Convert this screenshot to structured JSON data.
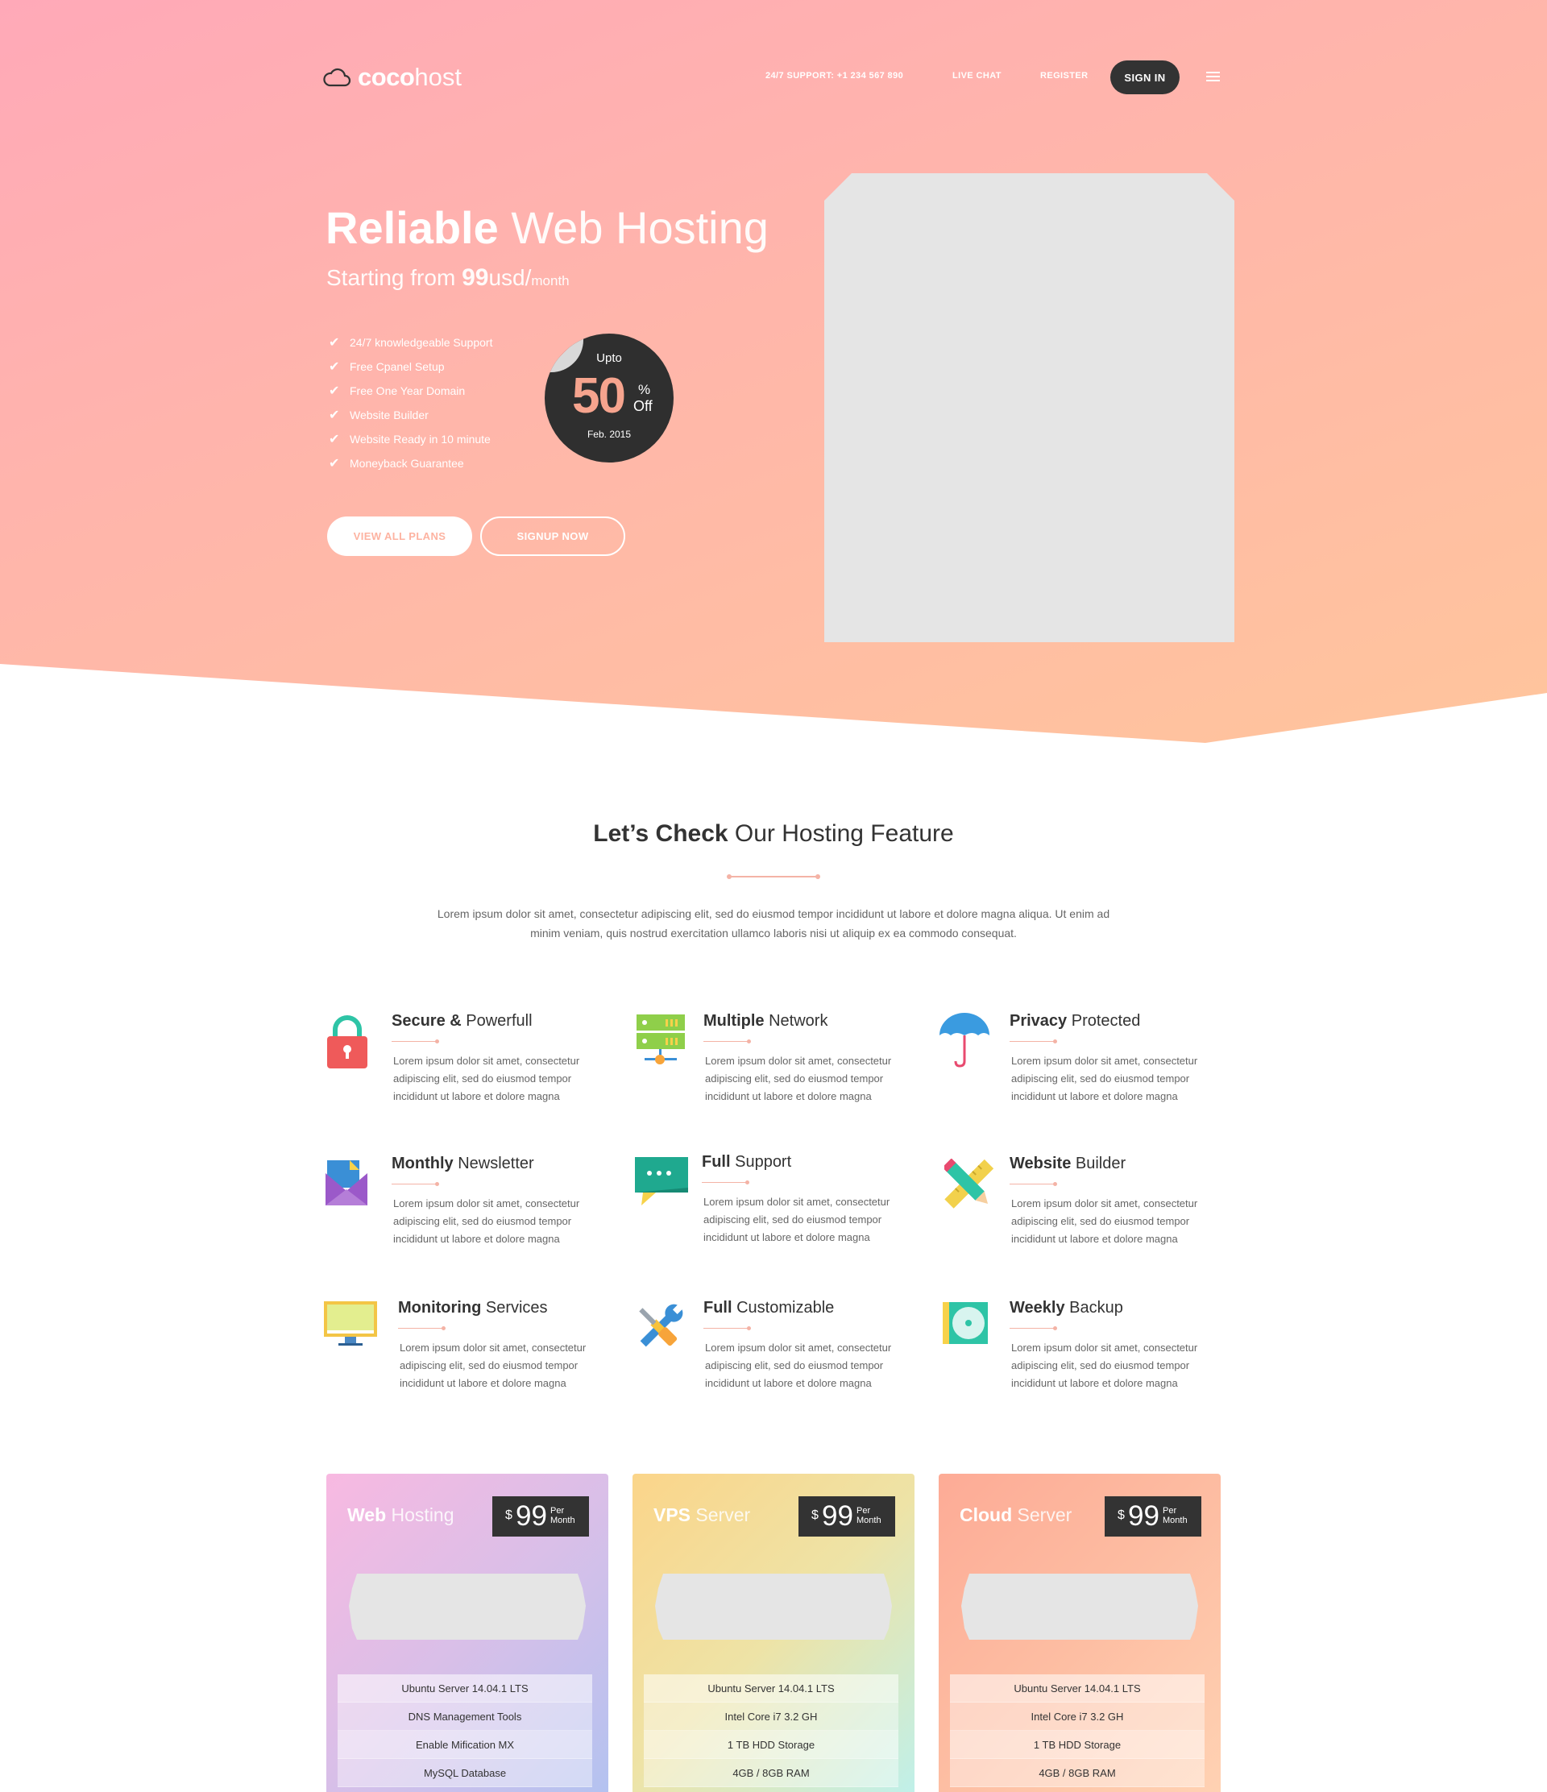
{
  "brand": {
    "bold": "coco",
    "light": "host"
  },
  "nav": {
    "support": "24/7 SUPPORT: +1 234 567 890",
    "live_chat": "LIVE CHAT",
    "register": "REGISTER",
    "sign_in": "SIGN IN"
  },
  "hero": {
    "title_bold": "Reliable",
    "title_light": "Web Hosting",
    "sub_prefix": "Starting from ",
    "sub_price": "99",
    "sub_unit": "usd/",
    "sub_period": "month",
    "list": [
      "24/7 knowledgeable Support",
      "Free Cpanel Setup",
      "Free One Year Domain",
      "Website Builder",
      "Website Ready in 10 minute",
      "Moneyback Guarantee"
    ],
    "badge": {
      "upto": "Upto",
      "num": "50",
      "pct": "%",
      "off": "Off",
      "date": "Feb. 2015"
    },
    "btn_plans": "VIEW ALL PLANS",
    "btn_signup": "SIGNUP NOW"
  },
  "features": {
    "title_bold": "Let’s Check",
    "title_light": " Our Hosting Feature",
    "desc": "Lorem ipsum dolor sit amet, consectetur adipiscing elit, sed do eiusmod tempor incididunt ut labore et dolore magna aliqua. Ut enim ad minim veniam, quis nostrud exercitation ullamco laboris nisi ut aliquip ex ea commodo consequat.",
    "items": [
      {
        "bold": "Secure &",
        "light": " Powerfull",
        "desc": "Lorem ipsum dolor sit amet, consectetur adipiscing elit, sed do eiusmod tempor incididunt ut labore et dolore magna",
        "icon": "padlock-icon"
      },
      {
        "bold": "Multiple",
        "light": " Network",
        "desc": "Lorem ipsum dolor sit amet, consectetur adipiscing elit, sed do eiusmod tempor incididunt ut labore et dolore magna",
        "icon": "server-network-icon"
      },
      {
        "bold": "Privacy",
        "light": " Protected",
        "desc": "Lorem ipsum dolor sit amet, consectetur adipiscing elit, sed do eiusmod tempor incididunt ut labore et dolore magna",
        "icon": "umbrella-icon"
      },
      {
        "bold": "Monthly",
        "light": " Newsletter",
        "desc": "Lorem ipsum dolor sit amet, consectetur adipiscing elit, sed do eiusmod tempor incididunt ut labore et dolore magna",
        "icon": "envelope-icon"
      },
      {
        "bold": "Full",
        "light": " Support",
        "desc": "Lorem ipsum dolor sit amet, consectetur adipiscing elit, sed do eiusmod tempor incididunt ut labore et dolore magna",
        "icon": "chat-bubble-icon"
      },
      {
        "bold": "Website",
        "light": " Builder",
        "desc": "Lorem ipsum dolor sit amet, consectetur adipiscing elit, sed do eiusmod tempor incididunt ut labore et dolore magna",
        "icon": "pencil-ruler-icon"
      },
      {
        "bold": "Monitoring",
        "light": " Services",
        "desc": "Lorem ipsum dolor sit amet, consectetur adipiscing elit, sed do eiusmod tempor incididunt ut labore et dolore magna",
        "icon": "monitor-icon"
      },
      {
        "bold": "Full",
        "light": " Customizable",
        "desc": "Lorem ipsum dolor sit amet, consectetur adipiscing elit, sed do eiusmod tempor incididunt ut labore et dolore magna",
        "icon": "wrench-screwdriver-icon"
      },
      {
        "bold": "Weekly",
        "light": " Backup",
        "desc": "Lorem ipsum dolor sit amet, consectetur adipiscing elit, sed do eiusmod tempor incididunt ut labore et dolore magna",
        "icon": "disc-backup-icon"
      }
    ]
  },
  "pricing": [
    {
      "bold": "Web",
      "light": " Hosting",
      "currency": "$",
      "price": "99",
      "per1": "Per",
      "per2": "Month",
      "items": [
        "Ubuntu Server 14.04.1 LTS",
        "DNS Management Tools",
        "Enable Mification MX",
        "MySQL Database"
      ]
    },
    {
      "bold": "VPS",
      "light": " Server",
      "currency": "$",
      "price": "99",
      "per1": "Per",
      "per2": "Month",
      "items": [
        "Ubuntu Server 14.04.1 LTS",
        "Intel Core i7 3.2 GH",
        "1 TB HDD Storage",
        "4GB / 8GB RAM"
      ]
    },
    {
      "bold": "Cloud",
      "light": " Server",
      "currency": "$",
      "price": "99",
      "per1": "Per",
      "per2": "Month",
      "items": [
        "Ubuntu Server 14.04.1 LTS",
        "Intel Core i7 3.2 GH",
        "1 TB HDD Storage",
        "4GB / 8GB RAM"
      ]
    }
  ],
  "colors": {
    "accent": "#f4b3a6",
    "dark": "#333333",
    "hero_start": "#ffa9b8",
    "hero_end": "#ffc59c",
    "card_web": [
      "#f8b9e1",
      "#b3c2f0"
    ],
    "card_vps": [
      "#fbd58a",
      "#bff0ea"
    ],
    "card_cloud": [
      "#fdab96",
      "#ffd2b3"
    ]
  }
}
